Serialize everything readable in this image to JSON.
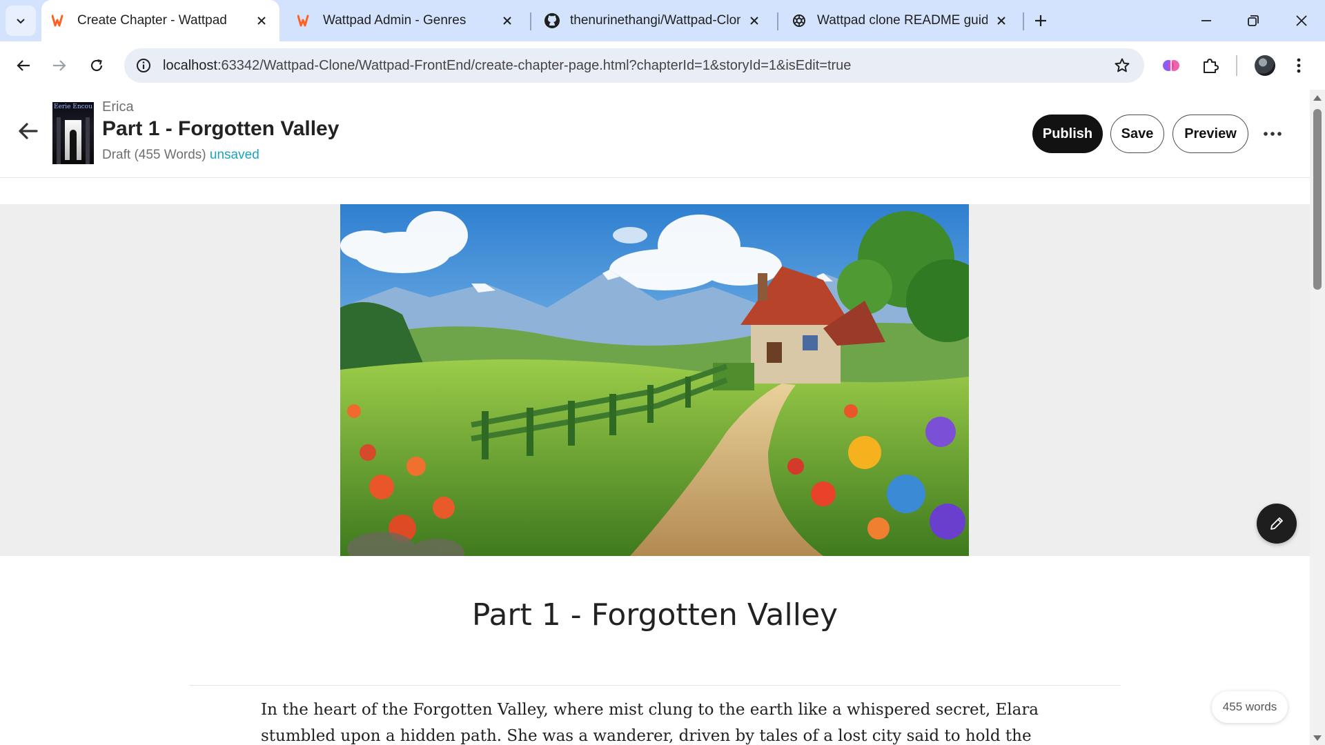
{
  "browser": {
    "tabs": [
      {
        "title": "Create Chapter - Wattpad",
        "icon": "wattpad-icon",
        "active": true
      },
      {
        "title": "Wattpad Admin - Genres",
        "icon": "wattpad-icon",
        "active": false
      },
      {
        "title": "thenurinethangi/Wattpad-Clone",
        "icon": "github-icon",
        "active": false
      },
      {
        "title": "Wattpad clone README guide",
        "icon": "chatgpt-icon",
        "active": false
      }
    ],
    "url_host": "localhost",
    "url_path": ":63342/Wattpad-Clone/Wattpad-FrontEnd/create-chapter-page.html?chapterId=1&storyId=1&isEdit=true"
  },
  "header": {
    "author": "Erica",
    "chapter_title": "Part 1 - Forgotten Valley",
    "draft_label": "Draft (455 Words)",
    "unsaved_label": "unsaved",
    "cover_title": "Eerie Encounters"
  },
  "actions": {
    "publish_label": "Publish",
    "save_label": "Save",
    "preview_label": "Preview"
  },
  "content": {
    "title": "Part 1 - Forgotten Valley",
    "body": "In the heart of the Forgotten Valley, where mist clung to the earth like a whispered secret, Elara stumbled upon a hidden path. She was a wanderer, driven by tales of a lost city said to hold the wisdom of ancient",
    "word_count": "455 words"
  },
  "colors": {
    "accent_unsaved": "#1aa3c2",
    "publish_bg": "#121212",
    "tabbar_bg": "#d3e3fd"
  }
}
